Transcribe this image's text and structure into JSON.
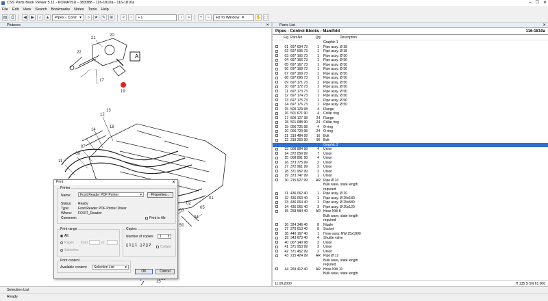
{
  "window": {
    "title": "CSS Parts Book Viewer 5.11 - KOMATSU - 383388 - 116-1810a - 116-1810a"
  },
  "menu": [
    "File",
    "Edit",
    "View",
    "Search",
    "Bookmarks",
    "Notes",
    "Tools",
    "Help"
  ],
  "toolbar": {
    "catalog_select": "Pipes - Contr",
    "page_select": "• 1",
    "zoom_select": "Fit To Window"
  },
  "pictures_pane": {
    "title": "Pictures"
  },
  "drawing": {
    "callout_a": "A",
    "labels": [
      "20",
      "21",
      "22",
      "17",
      "19",
      "12",
      "13",
      "14",
      "07",
      "08",
      "11",
      "18",
      "45",
      "40",
      "50",
      "04",
      "02",
      "03",
      "05",
      "01",
      "15",
      "16",
      "23"
    ]
  },
  "parts_pane": {
    "title": "Parts List",
    "header": "Pipes - Control Blocks - Manifold",
    "code": "116-1810a",
    "columns": [
      "Fig",
      "Part-No",
      "Qty",
      "Description"
    ],
    "selected_index": 23,
    "rows": [
      {
        "cb": false,
        "fig": "",
        "pn": "",
        "qty": "",
        "desc": "Graphic 1"
      },
      {
        "cb": true,
        "fig": "01",
        "pn": "697 694 73",
        "qty": "1",
        "desc": "Pipe assy. Ø 38"
      },
      {
        "cb": true,
        "fig": "02",
        "pn": "697 695 73",
        "qty": "1",
        "desc": "Pipe assy. Ø 38"
      },
      {
        "cb": true,
        "fig": "03",
        "pn": "697 165 73",
        "qty": "1",
        "desc": "Pipe assy. Ø 50"
      },
      {
        "cb": true,
        "fig": "04",
        "pn": "697 166 73",
        "qty": "1",
        "desc": "Pipe assy. Ø 50"
      },
      {
        "cb": true,
        "fig": "05",
        "pn": "697 167 73",
        "qty": "1",
        "desc": "Pipe assy. Ø 50"
      },
      {
        "cb": true,
        "fig": "06",
        "pn": "697 168 73",
        "qty": "1",
        "desc": "Pipe assy. Ø 50"
      },
      {
        "cb": true,
        "fig": "07",
        "pn": "697 169 73",
        "qty": "1",
        "desc": "Pipe assy. Ø 50"
      },
      {
        "cb": true,
        "fig": "08",
        "pn": "697 696 73",
        "qty": "1",
        "desc": "Pipe assy. Ø 50"
      },
      {
        "cb": true,
        "fig": "09",
        "pn": "697 171 73",
        "qty": "1",
        "desc": "Pipe assy. Ø 50"
      },
      {
        "cb": true,
        "fig": "10",
        "pn": "697 172 73",
        "qty": "1",
        "desc": "Pipe assy. Ø 50"
      },
      {
        "cb": true,
        "fig": "11",
        "pn": "697 173 73",
        "qty": "1",
        "desc": "Pipe assy. Ø 50"
      },
      {
        "cb": true,
        "fig": "12",
        "pn": "697 174 73",
        "qty": "1",
        "desc": "Pipe assy. Ø 50"
      },
      {
        "cb": true,
        "fig": "13",
        "pn": "697 175 73",
        "qty": "1",
        "desc": "Pipe assy. Ø 50"
      },
      {
        "cb": true,
        "fig": "14",
        "pn": "697 176 73",
        "qty": "1",
        "desc": "Pipe assy. Ø 50"
      },
      {
        "cb": true,
        "fig": "15",
        "pn": "500 129 98",
        "qty": "4",
        "desc": "Flange"
      },
      {
        "cb": true,
        "fig": "16",
        "pn": "501 671 90",
        "qty": "4",
        "desc": "Collar ring"
      },
      {
        "cb": true,
        "fig": "17",
        "pn": "500 127 98",
        "qty": "24",
        "desc": "Flange"
      },
      {
        "cb": true,
        "fig": "18",
        "pn": "501 688 90",
        "qty": "24",
        "desc": "Collar ring"
      },
      {
        "cb": true,
        "fig": "19",
        "pn": "006 725 98",
        "qty": "4",
        "desc": "O-ring"
      },
      {
        "cb": true,
        "fig": "20",
        "pn": "006 729 98",
        "qty": "24",
        "desc": "O-ring"
      },
      {
        "cb": true,
        "fig": "21",
        "pn": "319 484 99",
        "qty": "16",
        "desc": "Bolt"
      },
      {
        "cb": true,
        "fig": "22",
        "pn": "319 269 99",
        "qty": "96",
        "desc": "Bolt"
      },
      {
        "cb": false,
        "fig": "",
        "pn": "",
        "qty": "",
        "desc": "Graphic 2"
      },
      {
        "cb": true,
        "fig": "23",
        "pn": "008 884 98",
        "qty": "4",
        "desc": "Union"
      },
      {
        "cb": true,
        "fig": "24",
        "pn": "372 059 99",
        "qty": "7",
        "desc": "Union"
      },
      {
        "cb": true,
        "fig": "25",
        "pn": "008 891 98",
        "qty": "4",
        "desc": "Union"
      },
      {
        "cb": true,
        "fig": "26",
        "pn": "373 775 99",
        "qty": "2",
        "desc": "Union"
      },
      {
        "cb": true,
        "fig": "27",
        "pn": "372 961 99",
        "qty": "2",
        "desc": "Union"
      },
      {
        "cb": true,
        "fig": "28",
        "pn": "371 952 99",
        "qty": "3",
        "desc": "Union"
      },
      {
        "cb": true,
        "fig": "29",
        "pn": "373 747 99",
        "qty": "1",
        "desc": "Union"
      },
      {
        "cb": true,
        "fig": "30",
        "pn": "215 627 99",
        "qty": "AR",
        "desc": "Pipe Ø 10"
      },
      {
        "cb": false,
        "fig": "",
        "pn": "",
        "qty": "",
        "desc": "Bulk ware, state length"
      },
      {
        "cb": false,
        "fig": "",
        "pn": "",
        "qty": "",
        "desc": "required"
      },
      {
        "cb": true,
        "fig": "31",
        "pn": "436 062 40",
        "qty": "1",
        "desc": "Pipe assy. Ø 20"
      },
      {
        "cb": true,
        "fig": "32",
        "pn": "436 063 40",
        "qty": "1",
        "desc": "Pipe assy. Ø 25x180"
      },
      {
        "cb": true,
        "fig": "33",
        "pn": "436 064 40",
        "qty": "1",
        "desc": "Pipe assy. Ø 25x580"
      },
      {
        "cb": true,
        "fig": "34",
        "pn": "436 065 40",
        "qty": "3",
        "desc": "Pipe assy. Ø 20x120"
      },
      {
        "cb": true,
        "fig": "35",
        "pn": "258 584 40",
        "qty": "AR",
        "desc": "Hose NW 8"
      },
      {
        "cb": false,
        "fig": "",
        "pn": "",
        "qty": "",
        "desc": "Bulk ware, state length"
      },
      {
        "cb": false,
        "fig": "",
        "pn": "",
        "qty": "",
        "desc": "required"
      },
      {
        "cb": true,
        "fig": "36",
        "pn": "324 346 40",
        "qty": "8",
        "desc": "Nipple"
      },
      {
        "cb": true,
        "fig": "37",
        "pn": "270 613 40",
        "qty": "8",
        "desc": "Socket"
      },
      {
        "cb": true,
        "fig": "38",
        "pn": "440 167 40",
        "qty": "1",
        "desc": "Hose assy. NW 25x1800"
      },
      {
        "cb": true,
        "fig": "39",
        "pn": "343 673 40",
        "qty": "4",
        "desc": "Shuttle valve"
      },
      {
        "cb": true,
        "fig": "40",
        "pn": "007 140 98",
        "qty": "3",
        "desc": "Union"
      },
      {
        "cb": true,
        "fig": "41",
        "pn": "371 953 99",
        "qty": "3",
        "desc": "Union"
      },
      {
        "cb": true,
        "fig": "42",
        "pn": "371 452 99",
        "qty": "2",
        "desc": "Union"
      },
      {
        "cb": true,
        "fig": "43",
        "pn": "215 424 99",
        "qty": "AR",
        "desc": "Pipe Ø 12"
      },
      {
        "cb": false,
        "fig": "",
        "pn": "",
        "qty": "",
        "desc": "Bulk ware, state length"
      },
      {
        "cb": false,
        "fig": "",
        "pn": "",
        "qty": "",
        "desc": "required"
      },
      {
        "cb": true,
        "fig": "44",
        "pn": "269 412 40",
        "qty": "AR",
        "desc": "Hose NW 10"
      },
      {
        "cb": false,
        "fig": "",
        "pn": "",
        "qty": "",
        "desc": "Bulk ware, state length"
      }
    ],
    "footer_left": "11.09.2000",
    "footer_right": "H 135 S SN 61 006"
  },
  "bottom_tab": "Selection List",
  "status": "Ready",
  "print_dialog": {
    "title": "Print",
    "printer_group": "Printer",
    "name_label": "Name:",
    "name_value": "Foxit Reader PDF Printer",
    "properties_btn": "Properties...",
    "status_label": "Status:",
    "status_value": "Ready",
    "type_label": "Type:",
    "type_value": "Foxit Reader PDF Printer Driver",
    "where_label": "Where:",
    "where_value": "FOXIT_Reader:",
    "comment_label": "Comment:",
    "print_to_file": "Print to file",
    "range_group": "Print range",
    "range_all": "All",
    "range_pages": "Pages",
    "range_from": "from:",
    "range_to": "to:",
    "range_selection": "Selection",
    "copies_group": "Copies",
    "copies_label": "Number of copies:",
    "copies_value": "1",
    "collate": "Collate",
    "content_group": "Print content",
    "available_label": "Available content:",
    "available_value": "Selection List",
    "ok": "OK",
    "cancel": "Cancel"
  }
}
